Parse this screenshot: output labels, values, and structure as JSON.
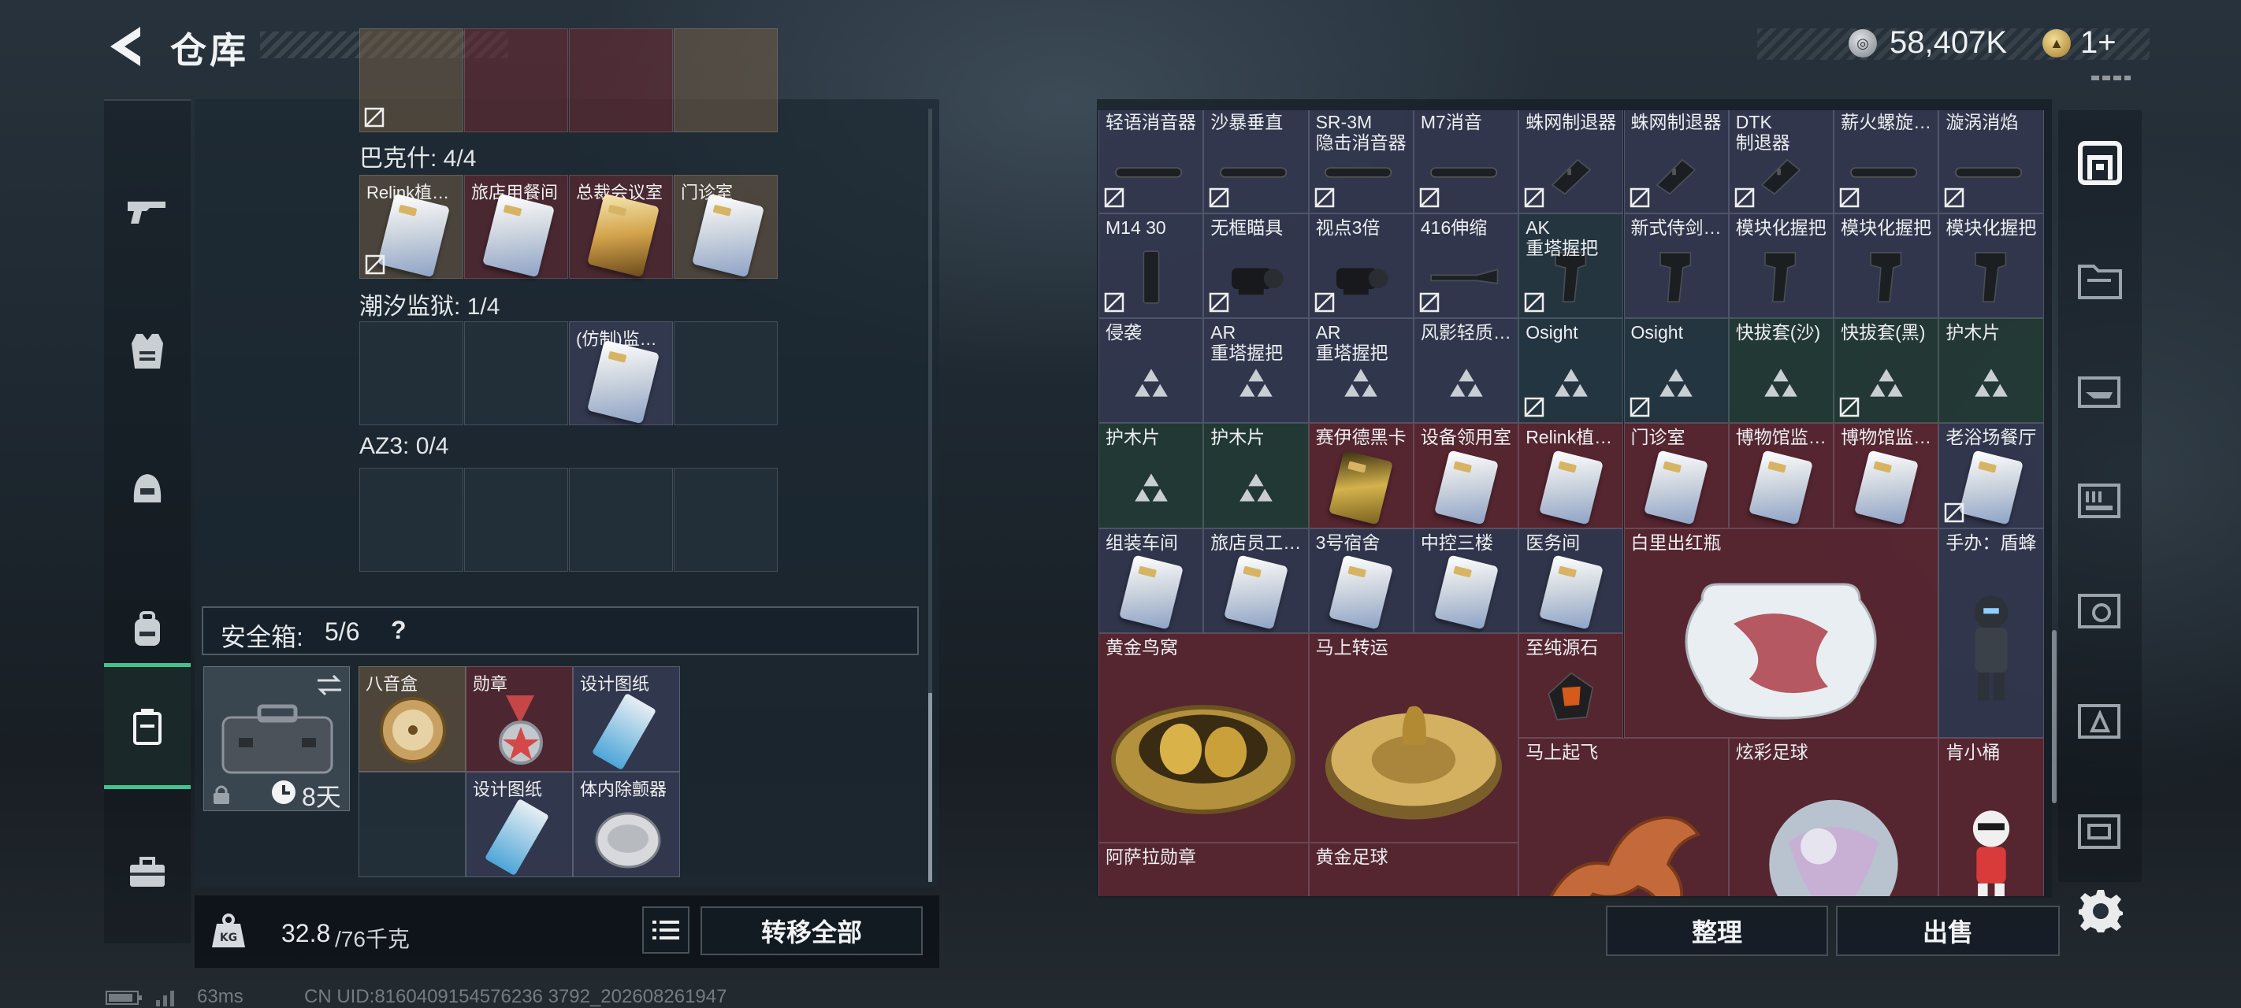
{
  "header": {
    "title": "仓库",
    "currency_silver": "58,407K",
    "currency_gold": "1+"
  },
  "left_nav": {
    "items": [
      {
        "name": "weapons"
      },
      {
        "name": "armor"
      },
      {
        "name": "helmet"
      },
      {
        "name": "backpack"
      },
      {
        "name": "safe-box"
      },
      {
        "name": "toolkit"
      }
    ]
  },
  "stash": {
    "group_bakeshi": {
      "label": "巴克什: 4/4",
      "items": [
        "Relink植…",
        "旅店用餐间",
        "总裁会议室",
        "门诊室"
      ]
    },
    "group_chaoxi": {
      "label": "潮汐监狱: 1/4",
      "items": [
        "",
        "",
        "(仿制)监…",
        ""
      ]
    },
    "group_az3": {
      "label": "AZ3: 0/4",
      "items": [
        "",
        "",
        "",
        ""
      ]
    }
  },
  "safe_box": {
    "label": "安全箱:",
    "count": "5/6",
    "help": "?",
    "timer": "8天",
    "items": [
      {
        "label": "八音盒"
      },
      {
        "label": "勋章"
      },
      {
        "label": "设计图纸"
      },
      {
        "label": ""
      },
      {
        "label": "设计图纸"
      },
      {
        "label": "体内除颤器"
      }
    ]
  },
  "bottom_bar": {
    "weight_value": "32.8",
    "weight_total": "/76千克",
    "transfer_all": "转移全部"
  },
  "status": {
    "ping": "63ms",
    "uid": "CN UID:8160409154576236 3792_202608261947"
  },
  "right_grid": {
    "items": [
      {
        "label": "轻语消音器"
      },
      {
        "label": "沙暴垂直"
      },
      {
        "label": "SR-3M\n隐击消音器"
      },
      {
        "label": "M7消音"
      },
      {
        "label": "蛛网制退器"
      },
      {
        "label": "蛛网制退器"
      },
      {
        "label": "DTK\n制退器"
      },
      {
        "label": "薪火螺旋…"
      },
      {
        "label": "漩涡消焰"
      },
      {
        "label": "M14 30"
      },
      {
        "label": "无框瞄具"
      },
      {
        "label": "视点3倍"
      },
      {
        "label": "416伸缩"
      },
      {
        "label": "AK\n重塔握把"
      },
      {
        "label": "新式侍剑…"
      },
      {
        "label": "模块化握把"
      },
      {
        "label": "模块化握把"
      },
      {
        "label": "模块化握把"
      },
      {
        "label": "侵袭"
      },
      {
        "label": "AR\n重塔握把"
      },
      {
        "label": "AR\n重塔握把"
      },
      {
        "label": "风影轻质…"
      },
      {
        "label": "Osight"
      },
      {
        "label": "Osight"
      },
      {
        "label": "快拔套(沙)"
      },
      {
        "label": "快拔套(黑)"
      },
      {
        "label": "护木片"
      },
      {
        "label": "护木片"
      },
      {
        "label": "护木片"
      },
      {
        "label": "赛伊德黑卡"
      },
      {
        "label": "设备领用室"
      },
      {
        "label": "Relink植…"
      },
      {
        "label": "门诊室"
      },
      {
        "label": "博物馆监…"
      },
      {
        "label": "博物馆监…"
      },
      {
        "label": "老浴场餐厅"
      },
      {
        "label": "组装车间"
      },
      {
        "label": "旅店员工…"
      },
      {
        "label": "3号宿舍"
      },
      {
        "label": "中控三楼"
      },
      {
        "label": "医务间"
      },
      {
        "label": "白里出红瓶"
      },
      {
        "label": "手办：盾蜂"
      },
      {
        "label": "黄金鸟窝"
      },
      {
        "label": "马上转运"
      },
      {
        "label": "至纯源石"
      },
      {
        "label": "马上起飞"
      },
      {
        "label": "炫彩足球"
      },
      {
        "label": "肯小桶"
      },
      {
        "label": "阿萨拉勋章"
      },
      {
        "label": "黄金足球"
      }
    ]
  },
  "right_actions": {
    "sort": "整理",
    "sell": "出售"
  },
  "right_nav": {
    "items": [
      {
        "name": "storage-main"
      },
      {
        "name": "tab-2"
      },
      {
        "name": "tab-3"
      },
      {
        "name": "tab-4"
      },
      {
        "name": "tab-5"
      },
      {
        "name": "tab-6"
      },
      {
        "name": "tab-7"
      }
    ]
  },
  "colors": {
    "accent": "#43c28d",
    "red_rarity": "#6e2834",
    "purple_rarity": "#3a3e58",
    "green_rarity": "#263e38",
    "gold_rarity": "#7a5f46"
  }
}
